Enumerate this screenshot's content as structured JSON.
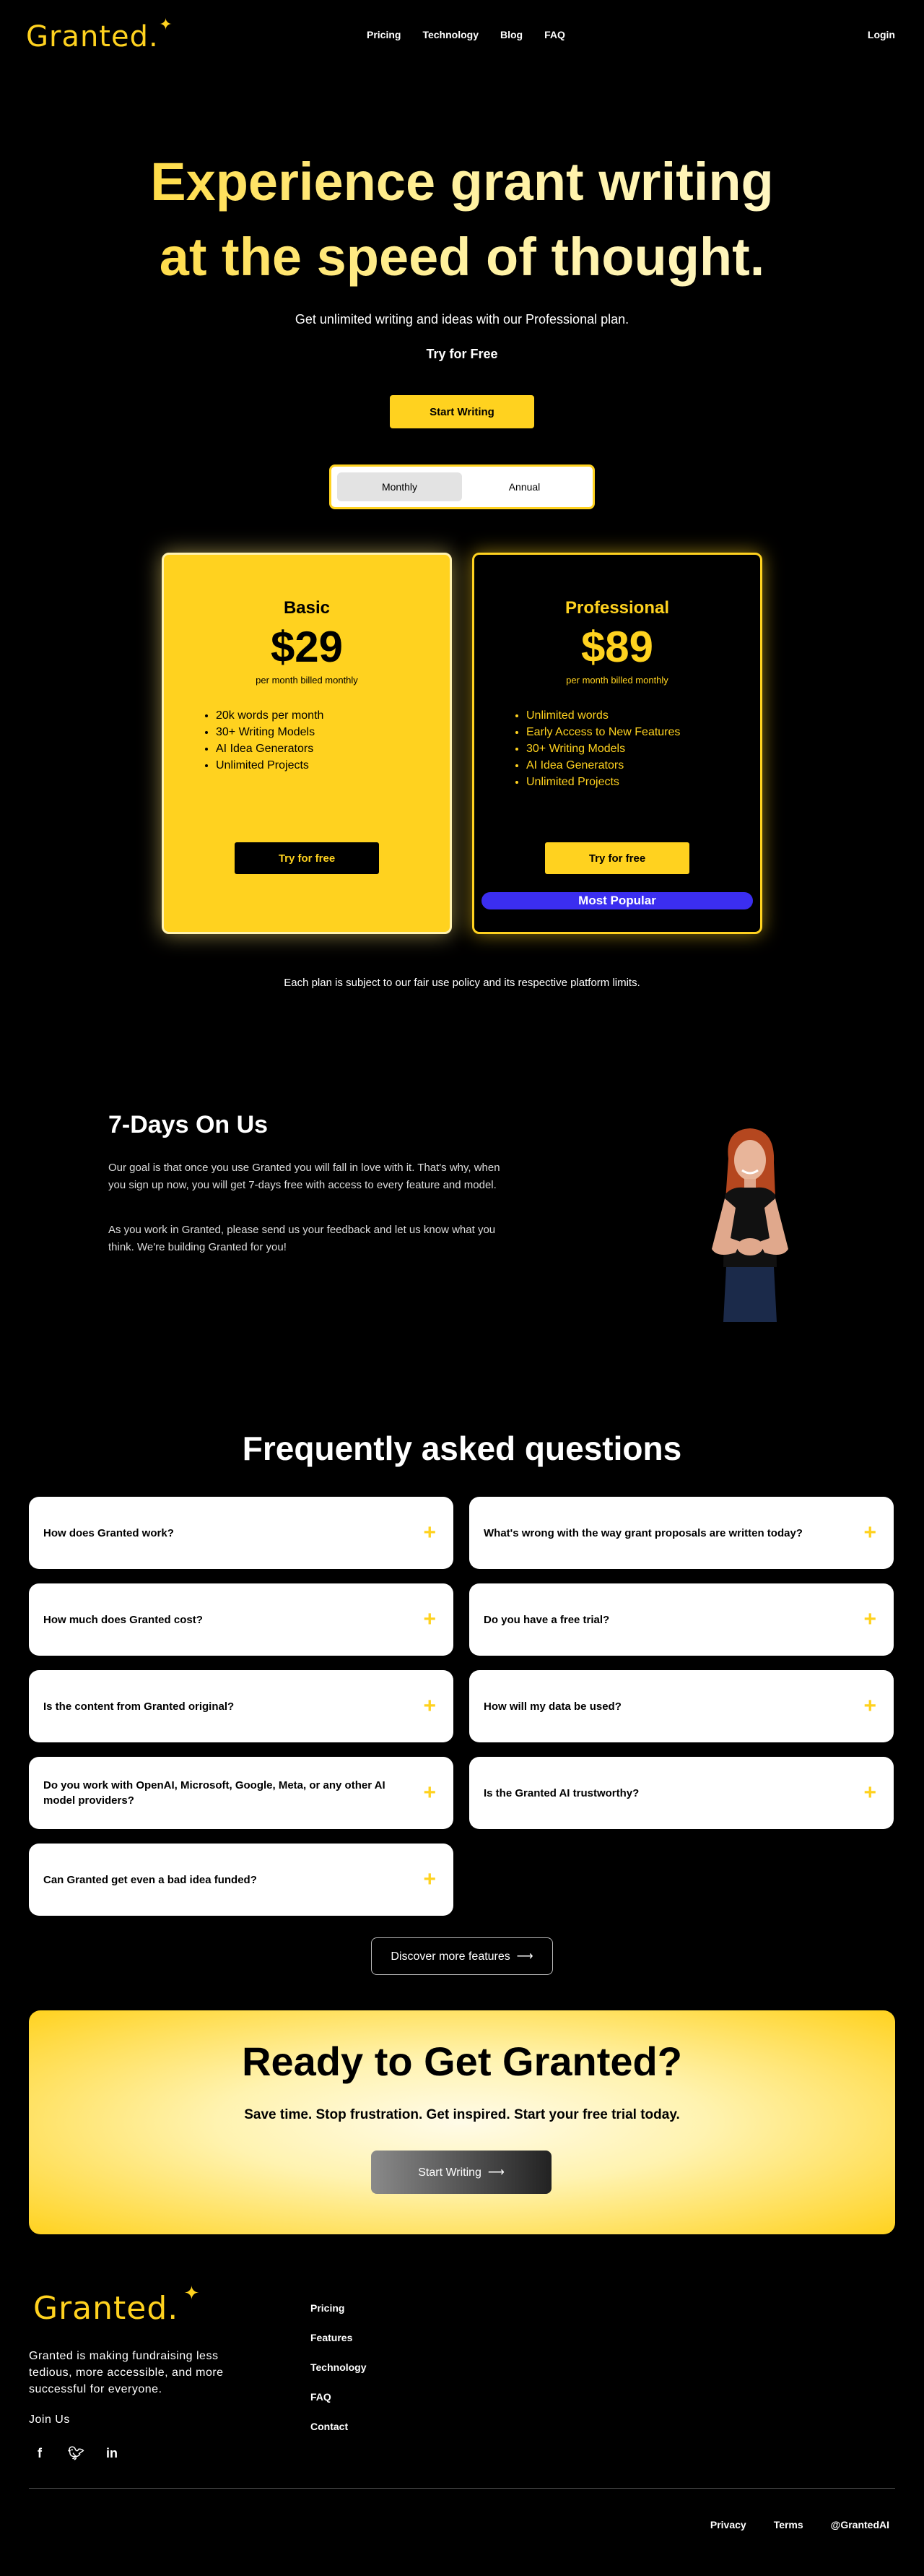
{
  "nav": {
    "logo": "Granted.",
    "links": [
      "Pricing",
      "Technology",
      "Blog",
      "FAQ"
    ],
    "login": "Login"
  },
  "hero": {
    "title_line1": "Experience grant writing",
    "title_line2": "at the speed of thought.",
    "subtitle": "Get unlimited writing and ideas with our Professional plan.",
    "try_label": "Try for Free",
    "start_button": "Start Writing"
  },
  "billing_toggle": {
    "monthly": "Monthly",
    "annual": "Annual",
    "selected": "Monthly"
  },
  "plans": {
    "basic": {
      "name": "Basic",
      "price": "$29",
      "period": "per month billed monthly",
      "features": [
        "20k words per month",
        "30+ Writing Models",
        "AI Idea Generators",
        "Unlimited Projects"
      ],
      "button": "Try for free"
    },
    "professional": {
      "name": "Professional",
      "price": "$89",
      "period": "per month billed monthly",
      "features": [
        "Unlimited words",
        "Early Access to New Features",
        "30+ Writing Models",
        "AI Idea Generators",
        "Unlimited Projects"
      ],
      "button": "Try for free",
      "badge": "Most Popular"
    }
  },
  "fair_use": "Each plan is subject to our fair use policy and its respective platform limits.",
  "trial": {
    "title": "7-Days On Us",
    "p1": "Our goal is that once you use Granted you will fall in love with it. That's why, when you sign up now, you will get 7-days free with access to every feature and model.",
    "p2": "As you work in Granted, please send us your feedback and let us know what you think. We're building Granted for you!"
  },
  "faq": {
    "title": "Frequently asked questions",
    "items": [
      "How does Granted work?",
      "What's wrong with the way grant proposals are written today?",
      "How much does Granted cost?",
      "Do you have a free trial?",
      "Is the content from Granted original?",
      "How will my data be used?",
      "Do you work with OpenAI, Microsoft, Google, Meta, or any other AI model providers?",
      "Is the Granted AI trustworthy?",
      "Can Granted get even a bad idea funded?"
    ],
    "discover": "Discover more features"
  },
  "cta": {
    "title": "Ready to Get Granted?",
    "subtitle": "Save time. Stop frustration. Get inspired. Start your free trial today.",
    "button": "Start Writing"
  },
  "footer": {
    "logo": "Granted.",
    "tagline": "Granted is making fundraising less tedious, more accessible, and more successful for everyone.",
    "join": "Join Us",
    "social": [
      "facebook-icon",
      "twitter-icon",
      "linkedin-icon"
    ],
    "links": [
      "Pricing",
      "Features",
      "Technology",
      "FAQ",
      "Contact"
    ],
    "bottom": [
      "Privacy",
      "Terms",
      "@GrantedAI"
    ]
  },
  "colors": {
    "accent": "#ffd21f",
    "background": "#000000",
    "badge": "#3b2ef0"
  }
}
